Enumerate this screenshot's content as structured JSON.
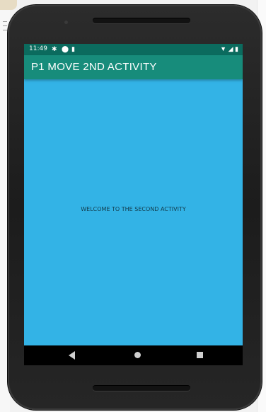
{
  "status_bar": {
    "time": "11:49",
    "icons_left": [
      "gear-icon",
      "shield-icon",
      "sim-card-icon"
    ],
    "icons_right": [
      "wifi-icon",
      "signal-icon",
      "battery-icon"
    ]
  },
  "app_bar": {
    "title": "P1 MOVE 2ND ACTIVITY",
    "color": "#178c7b"
  },
  "content": {
    "message": "WELCOME TO THE SECOND ACTIVITY",
    "background_color": "#33b3e6"
  },
  "nav_bar": {
    "buttons": [
      "back-icon",
      "home-icon",
      "recent-apps-icon"
    ]
  }
}
